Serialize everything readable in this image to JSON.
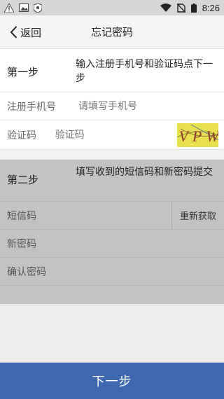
{
  "status_bar": {
    "time": "8:26",
    "icons": [
      "warning-icon",
      "image-icon",
      "shield-icon",
      "wifi-icon",
      "no-sim-icon",
      "battery-icon"
    ]
  },
  "header": {
    "back_label": "返回",
    "title": "忘记密码"
  },
  "step1": {
    "label": "第一步",
    "instruction": "输入注册手机号和验证码点下一步",
    "phone_label": "注册手机号",
    "phone_placeholder": "请填写手机号",
    "captcha_label": "验证码",
    "captcha_placeholder": "验证码",
    "captcha_text": "VPWG"
  },
  "step2": {
    "label": "第二步",
    "instruction": "填写收到的短信码和新密码提交",
    "sms_label": "短信码",
    "resend_label": "重新获取",
    "new_password_label": "新密码",
    "confirm_password_label": "确认密码"
  },
  "footer": {
    "next_label": "下一步"
  },
  "colors": {
    "primary": "#3f67ae",
    "disabled_section": "#c3c3c3",
    "captcha_bg": "#e8e14f"
  }
}
